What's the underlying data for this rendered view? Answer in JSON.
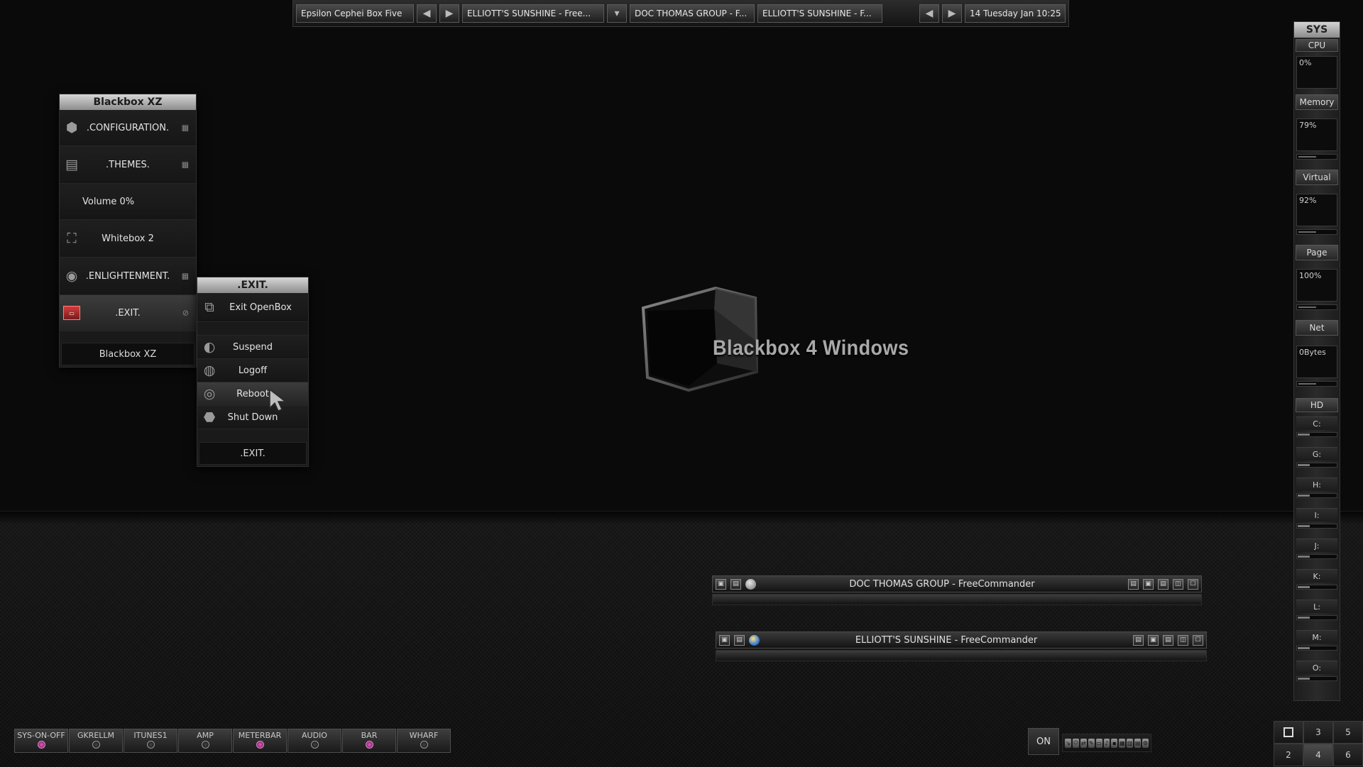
{
  "taskbar": {
    "workspace_label": "Epsilon Cephei Box Five",
    "tasks": [
      "ELLIOTT'S SUNSHINE - Free...",
      "DOC THOMAS GROUP - F...",
      "ELLIOTT'S SUNSHINE - F..."
    ],
    "clock": "14 Tuesday Jan 10:25"
  },
  "main_menu": {
    "title": "Blackbox XZ",
    "items": [
      {
        "label": ".CONFIGURATION.",
        "icon": "cube-icon"
      },
      {
        "label": ".THEMES.",
        "icon": "themes-icon"
      },
      {
        "label": "Volume  0%",
        "icon": ""
      },
      {
        "label": "Whitebox 2",
        "icon": "whitebox-icon"
      },
      {
        "label": ".ENLIGHTENMENT.",
        "icon": "disc-icon"
      },
      {
        "label": ".EXIT.",
        "icon": "exit-icon"
      }
    ],
    "footer": "Blackbox XZ"
  },
  "exit_menu": {
    "title": ".EXIT.",
    "items": [
      {
        "label": "Exit OpenBox"
      },
      {
        "label": "Suspend"
      },
      {
        "label": "Logoff"
      },
      {
        "label": "Reboot"
      },
      {
        "label": "Shut Down"
      }
    ],
    "footer": ".EXIT."
  },
  "desktop": {
    "logo_text": "Blackbox 4 Windows"
  },
  "windows": [
    {
      "title": "DOC THOMAS GROUP - FreeCommander"
    },
    {
      "title": "ELLIOTT'S SUNSHINE - FreeCommander"
    }
  ],
  "sys_panel": {
    "title": "SYS",
    "cpu_label": "CPU",
    "cpu_value": "0%",
    "memory_label": "Memory",
    "memory_value": "79%",
    "virtual_label": "Virtual",
    "virtual_value": "92%",
    "page_label": "Page",
    "page_value": "100%",
    "net_label": "Net",
    "net_value": "0Bytes",
    "hd_label": "HD",
    "drives": [
      "C:",
      "G:",
      "H:",
      "I:",
      "J:",
      "K:",
      "L:",
      "M:",
      "O:"
    ]
  },
  "launchers": [
    {
      "label": "SYS-ON-OFF",
      "led_on": true
    },
    {
      "label": "GKRELLM",
      "led_on": false
    },
    {
      "label": "ITUNES1",
      "led_on": false
    },
    {
      "label": "AMP",
      "led_on": false
    },
    {
      "label": "METERBAR",
      "led_on": true
    },
    {
      "label": "AUDIO",
      "led_on": false
    },
    {
      "label": "BAR",
      "led_on": true
    },
    {
      "label": "WHARF",
      "led_on": false
    }
  ],
  "tray": {
    "on_label": "ON"
  },
  "pager": {
    "workspaces": [
      "",
      "3",
      "5",
      "2",
      "4",
      "6"
    ]
  }
}
